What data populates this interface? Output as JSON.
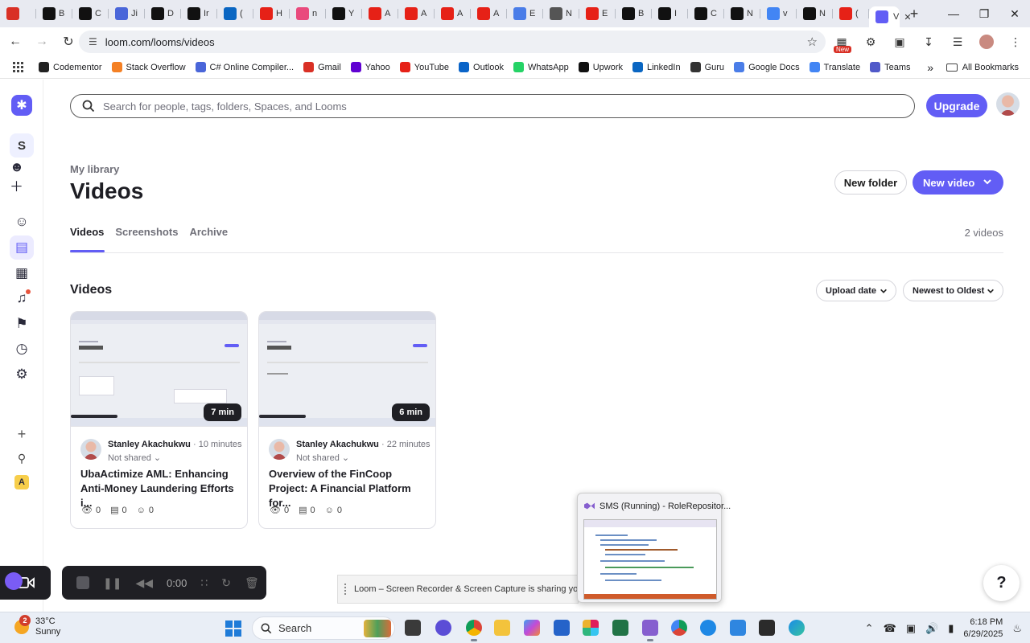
{
  "browser": {
    "tabs": [
      {
        "icon": "record-icon",
        "label": "",
        "color": "#d93025"
      },
      {
        "icon": "chatgpt-icon",
        "label": "B",
        "color": "#111111"
      },
      {
        "icon": "codementor-icon",
        "label": "C",
        "color": "#111111"
      },
      {
        "icon": "jira-icon",
        "label": "Ji",
        "color": "#4a66d9"
      },
      {
        "icon": "notion-icon",
        "label": "D",
        "color": "#111111"
      },
      {
        "icon": "notion-icon",
        "label": "Ir",
        "color": "#111111"
      },
      {
        "icon": "linkedin-icon",
        "label": "(",
        "color": "#0a66c2"
      },
      {
        "icon": "youtube-icon",
        "label": "H",
        "color": "#e62117"
      },
      {
        "icon": "doc-icon",
        "label": "n",
        "color": "#e94a7d"
      },
      {
        "icon": "github-icon",
        "label": "Y",
        "color": "#111111"
      },
      {
        "icon": "youtube-icon",
        "label": "A",
        "color": "#e62117"
      },
      {
        "icon": "youtube-icon",
        "label": "A",
        "color": "#e62117"
      },
      {
        "icon": "youtube-icon",
        "label": "A",
        "color": "#e62117"
      },
      {
        "icon": "youtube-icon",
        "label": "A",
        "color": "#e62117"
      },
      {
        "icon": "docs-icon",
        "label": "E",
        "color": "#4a7de8"
      },
      {
        "icon": "globe-icon",
        "label": "N",
        "color": "#555555"
      },
      {
        "icon": "youtube-icon",
        "label": "E",
        "color": "#e62117"
      },
      {
        "icon": "medium-icon",
        "label": "B",
        "color": "#111111"
      },
      {
        "icon": "medium-icon",
        "label": "I",
        "color": "#111111"
      },
      {
        "icon": "medium-icon",
        "label": "C",
        "color": "#111111"
      },
      {
        "icon": "medium-icon",
        "label": "N",
        "color": "#111111"
      },
      {
        "icon": "google-icon",
        "label": "v",
        "color": "#4285f4"
      },
      {
        "icon": "upwork-icon",
        "label": "N",
        "color": "#111111"
      },
      {
        "icon": "youtube-icon",
        "label": "(",
        "color": "#e62117"
      }
    ],
    "active_tab": {
      "label": "V"
    },
    "url": "loom.com/looms/videos",
    "bookmarks": [
      {
        "label": "Codementor",
        "color": "#222222"
      },
      {
        "label": "Stack Overflow",
        "color": "#f48024"
      },
      {
        "label": "C# Online Compiler...",
        "color": "#4a66d9"
      },
      {
        "label": "Gmail",
        "color": "#d93025"
      },
      {
        "label": "Yahoo",
        "color": "#6001d2"
      },
      {
        "label": "YouTube",
        "color": "#e62117"
      },
      {
        "label": "Outlook",
        "color": "#0a64c8"
      },
      {
        "label": "WhatsApp",
        "color": "#25d366"
      },
      {
        "label": "Upwork",
        "color": "#111111"
      },
      {
        "label": "LinkedIn",
        "color": "#0a66c2"
      },
      {
        "label": "Guru",
        "color": "#333333"
      },
      {
        "label": "Google Docs",
        "color": "#4a7de8"
      },
      {
        "label": "Translate",
        "color": "#4285f4"
      },
      {
        "label": "Teams",
        "color": "#5059c9"
      }
    ],
    "all_bookmarks": "All Bookmarks"
  },
  "loom": {
    "accent": "#625df5",
    "workspace_initial": "S",
    "workspace_a": "A",
    "search_placeholder": "Search for people, tags, folders, Spaces, and Looms",
    "upgrade_label": "Upgrade",
    "eyebrow": "My library",
    "title": "Videos",
    "new_folder": "New folder",
    "new_video": "New video",
    "tabs": [
      "Videos",
      "Screenshots",
      "Archive"
    ],
    "video_count": "2 videos",
    "section_title": "Videos",
    "sort_by": "Upload date",
    "sort_order": "Newest to Oldest",
    "videos": [
      {
        "duration": "7 min",
        "owner": "Stanley Akachukwu",
        "ago": "10 minutes",
        "sharing": "Not shared",
        "title": "UbaActimize AML: Enhancing Anti-Money Laundering Efforts i...",
        "views": "0",
        "comments": "0",
        "reactions": "0"
      },
      {
        "duration": "6 min",
        "owner": "Stanley Akachukwu",
        "ago": "22 minutes",
        "sharing": "Not shared",
        "title": "Overview of the FinCoop Project: A Financial Platform for...",
        "views": "0",
        "comments": "0",
        "reactions": "0"
      }
    ],
    "recorder_time": "0:00"
  },
  "overlay": {
    "sharing_notice": "Loom – Screen Recorder & Screen Capture is sharing your scre",
    "popup_title": "SMS (Running) - RoleRepositor..."
  },
  "taskbar": {
    "temperature": "33°C",
    "condition": "Sunny",
    "weather_badge": "2",
    "search_label": "Search",
    "time": "6:18 PM",
    "date": "6/29/2025"
  }
}
